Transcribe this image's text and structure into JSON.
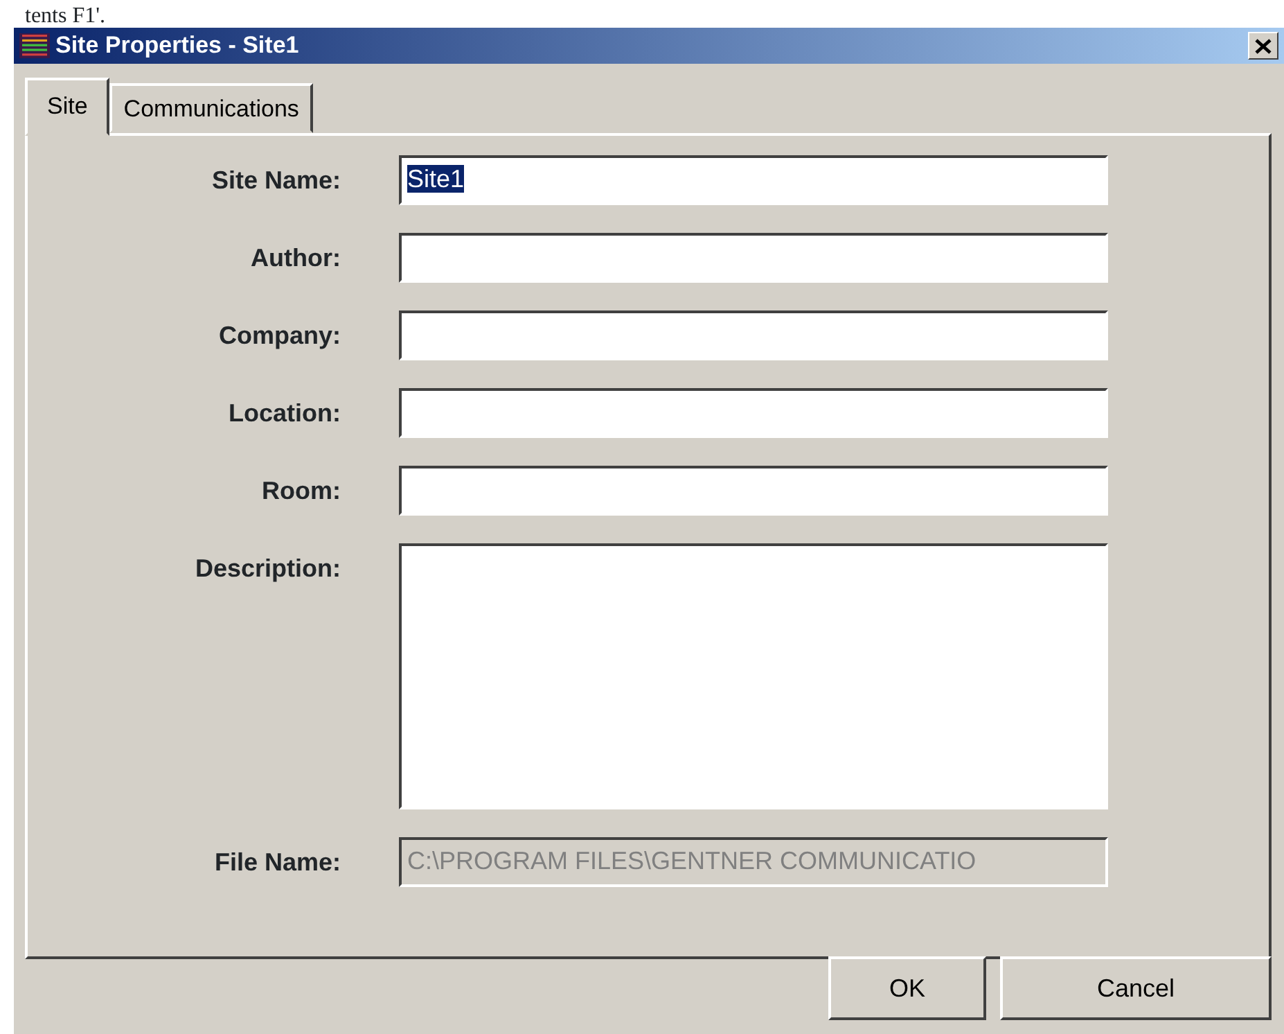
{
  "clipped_text": "tents F1'.",
  "window": {
    "title": "Site Properties - Site1"
  },
  "tabs": [
    {
      "label": "Site",
      "selected": true
    },
    {
      "label": "Communications",
      "selected": false
    }
  ],
  "fields": [
    {
      "label": "Site Name:",
      "value": "Site1",
      "text_selected": true,
      "kind": "line",
      "disabled": false
    },
    {
      "label": "Author:",
      "kind": "line",
      "disabled": false
    },
    {
      "label": "Company:",
      "kind": "line",
      "disabled": false
    },
    {
      "label": "Location:",
      "kind": "line",
      "disabled": false
    },
    {
      "label": "Room:",
      "kind": "line",
      "disabled": false
    },
    {
      "label": "Description:",
      "kind": "multiline",
      "disabled": false
    },
    {
      "label": "File Name:",
      "value": "C:\\PROGRAM FILES\\GENTNER COMMUNICATIO",
      "kind": "line",
      "disabled": true
    }
  ],
  "buttons": [
    "OK",
    "Cancel"
  ]
}
